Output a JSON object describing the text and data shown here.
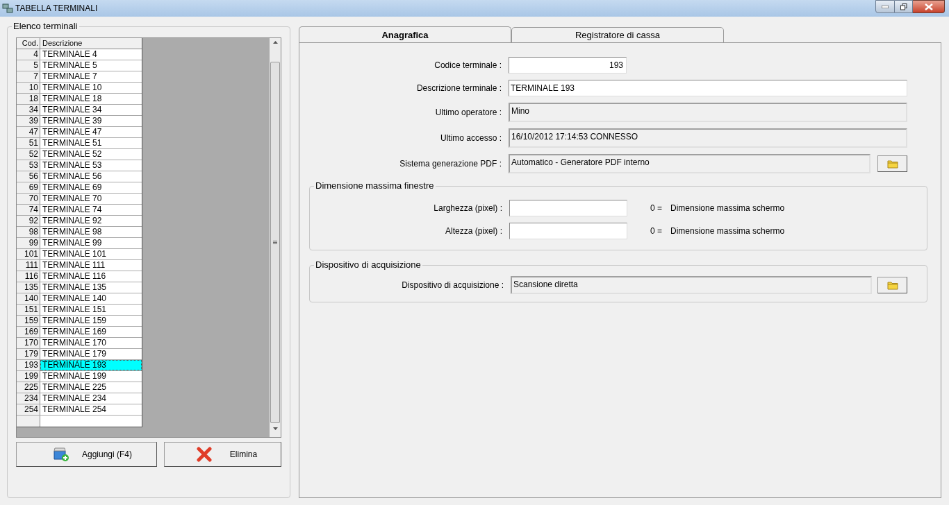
{
  "window": {
    "title": "TABELLA TERMINALI"
  },
  "list_group": {
    "title": "Elenco terminali",
    "columns": [
      "Cod.",
      "Descrizione"
    ],
    "rows": [
      {
        "code": "4",
        "description": "TERMINALE 4",
        "selected": false
      },
      {
        "code": "5",
        "description": "TERMINALE 5",
        "selected": false
      },
      {
        "code": "7",
        "description": "TERMINALE 7",
        "selected": false
      },
      {
        "code": "10",
        "description": "TERMINALE 10",
        "selected": false
      },
      {
        "code": "18",
        "description": "TERMINALE 18",
        "selected": false
      },
      {
        "code": "34",
        "description": "TERMINALE 34",
        "selected": false
      },
      {
        "code": "39",
        "description": "TERMINALE 39",
        "selected": false
      },
      {
        "code": "47",
        "description": "TERMINALE 47",
        "selected": false
      },
      {
        "code": "51",
        "description": "TERMINALE 51",
        "selected": false
      },
      {
        "code": "52",
        "description": "TERMINALE 52",
        "selected": false
      },
      {
        "code": "53",
        "description": "TERMINALE 53",
        "selected": false
      },
      {
        "code": "56",
        "description": "TERMINALE 56",
        "selected": false
      },
      {
        "code": "69",
        "description": "TERMINALE 69",
        "selected": false
      },
      {
        "code": "70",
        "description": "TERMINALE 70",
        "selected": false
      },
      {
        "code": "74",
        "description": "TERMINALE 74",
        "selected": false
      },
      {
        "code": "92",
        "description": "TERMINALE 92",
        "selected": false
      },
      {
        "code": "98",
        "description": "TERMINALE 98",
        "selected": false
      },
      {
        "code": "99",
        "description": "TERMINALE 99",
        "selected": false
      },
      {
        "code": "101",
        "description": "TERMINALE 101",
        "selected": false
      },
      {
        "code": "111",
        "description": "TERMINALE 111",
        "selected": false
      },
      {
        "code": "116",
        "description": "TERMINALE 116",
        "selected": false
      },
      {
        "code": "135",
        "description": "TERMINALE 135",
        "selected": false
      },
      {
        "code": "140",
        "description": "TERMINALE 140",
        "selected": false
      },
      {
        "code": "151",
        "description": "TERMINALE 151",
        "selected": false
      },
      {
        "code": "159",
        "description": "TERMINALE 159",
        "selected": false
      },
      {
        "code": "169",
        "description": "TERMINALE 169",
        "selected": false
      },
      {
        "code": "170",
        "description": "TERMINALE 170",
        "selected": false
      },
      {
        "code": "179",
        "description": "TERMINALE 179",
        "selected": false
      },
      {
        "code": "193",
        "description": "TERMINALE 193",
        "selected": true
      },
      {
        "code": "199",
        "description": "TERMINALE 199",
        "selected": false
      },
      {
        "code": "225",
        "description": "TERMINALE 225",
        "selected": false
      },
      {
        "code": "234",
        "description": "TERMINALE 234",
        "selected": false
      },
      {
        "code": "254",
        "description": "TERMINALE 254",
        "selected": false
      }
    ],
    "buttons": [
      {
        "kind": "add",
        "label": "Aggiungi (F4)"
      },
      {
        "kind": "delete",
        "label": "Elimina"
      }
    ]
  },
  "tabs": [
    {
      "label": "Anagrafica",
      "selected": true
    },
    {
      "label": "Registratore di cassa",
      "selected": false
    }
  ],
  "fields": [
    {
      "label": "Codice terminale :",
      "value": "193",
      "kind": "code"
    },
    {
      "label": "Descrizione terminale :",
      "value": "TERMINALE 193",
      "kind": "text"
    },
    {
      "label": "Ultimo operatore :",
      "value": "Mino",
      "kind": "readonly"
    },
    {
      "label": "Ultimo accesso :",
      "value": "16/10/2012  17:14:53  CONNESSO",
      "kind": "readonly"
    },
    {
      "label": "Sistema generazione PDF :",
      "value": "Automatico - Generatore PDF interno",
      "kind": "picker"
    }
  ],
  "window_size_group": {
    "title": "Dimensione massima finestre",
    "rows": [
      {
        "label": "Larghezza (pixel) :",
        "hint_value": "0 =",
        "hint": "Dimensione massima schermo"
      },
      {
        "label": "Altezza (pixel) :",
        "hint_value": "0 =",
        "hint": "Dimensione massima schermo"
      }
    ]
  },
  "acquisition_group": {
    "title": "Dispositivo di acquisizione",
    "label": "Dispositivo di acquisizione :",
    "value": "Scansione diretta"
  }
}
